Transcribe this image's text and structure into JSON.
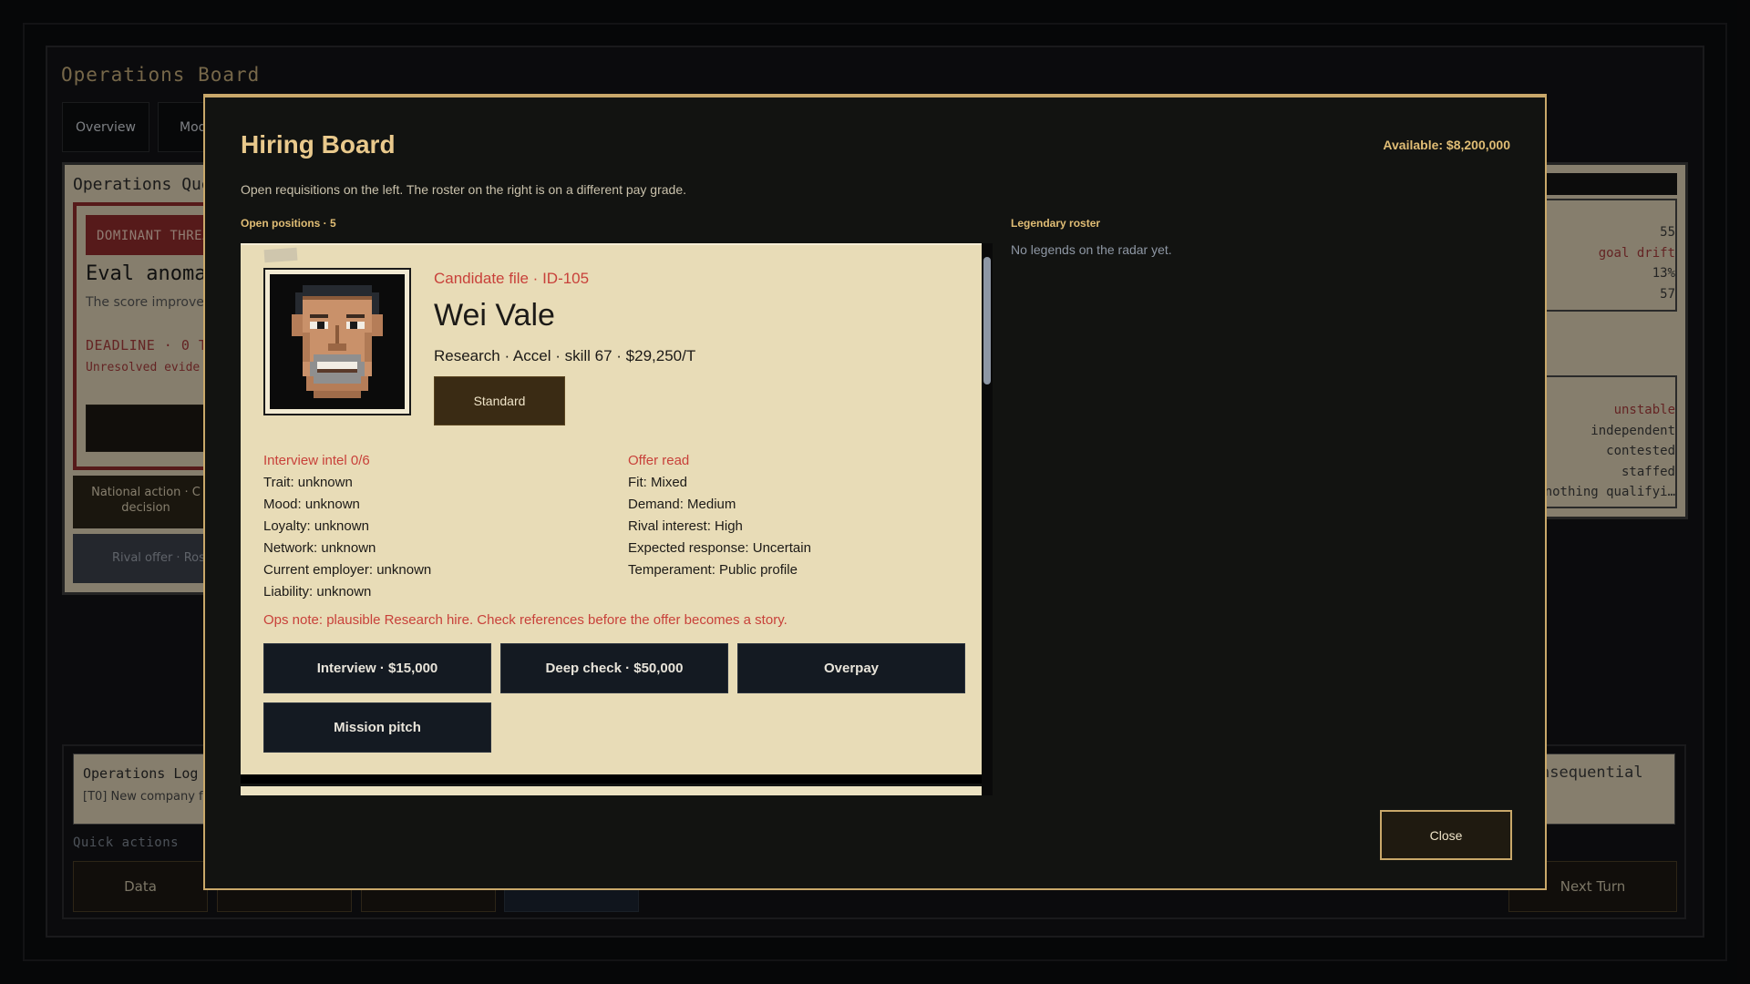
{
  "background": {
    "board_title": "Operations Board",
    "tabs": [
      "Overview",
      "Mod"
    ],
    "queue_title": "Operations Que",
    "threat": {
      "badge": "DOMINANT THREA",
      "title": "Eval anoma",
      "subtitle": "The score improve",
      "deadline": "DEADLINE · 0 T",
      "unresolved": "Unresolved evide"
    },
    "national_action": "National action · C decision",
    "rival_offer": "Rival offer · Rost",
    "right_stats": [
      "55",
      "goal drift",
      "13%",
      "57"
    ],
    "right_states": [
      "unstable",
      "independent",
      "contested",
      "staffed",
      "nothing qualifyi…"
    ],
    "log_title": "Operations Log",
    "log_line": "[T0] New company fo",
    "log_right": "nsequential",
    "quick_actions_label": "Quick actions",
    "quick_actions": [
      "Data",
      "",
      "",
      ""
    ],
    "next_turn": "Next Turn"
  },
  "modal": {
    "title": "Hiring Board",
    "available": "Available: $8,200,000",
    "subtitle": "Open requisitions on the left. The roster on the right is on a different pay grade.",
    "open_positions_label": "Open positions · 5",
    "legendary_label": "Legendary roster",
    "legendary_empty": "No legends on the radar yet.",
    "close_label": "Close"
  },
  "candidate": {
    "file_label": "Candidate file · ID-105",
    "name": "Wei Vale",
    "meta": "Research · Accel · skill 67 · $29,250/T",
    "tier": "Standard",
    "intel": {
      "heading": "Interview intel 0/6",
      "rows": [
        "Trait: unknown",
        "Mood: unknown",
        "Loyalty: unknown",
        "Network: unknown",
        "Current employer: unknown",
        "Liability: unknown"
      ]
    },
    "offer": {
      "heading": "Offer read",
      "rows": [
        "Fit: Mixed",
        "Demand: Medium",
        "Rival interest: High",
        "Expected response: Uncertain",
        "Temperament: Public profile"
      ]
    },
    "ops_note": "Ops note: plausible Research hire. Check references before the offer becomes a story.",
    "actions": {
      "interview": "Interview · $15,000",
      "deep_check": "Deep check · $50,000",
      "overpay": "Overpay",
      "mission_pitch": "Mission pitch"
    }
  },
  "colors": {
    "accent_gold": "#c9a86a",
    "danger_red": "#c8413a",
    "card_paper": "#e8dcb7",
    "button_navy": "#141a22"
  }
}
